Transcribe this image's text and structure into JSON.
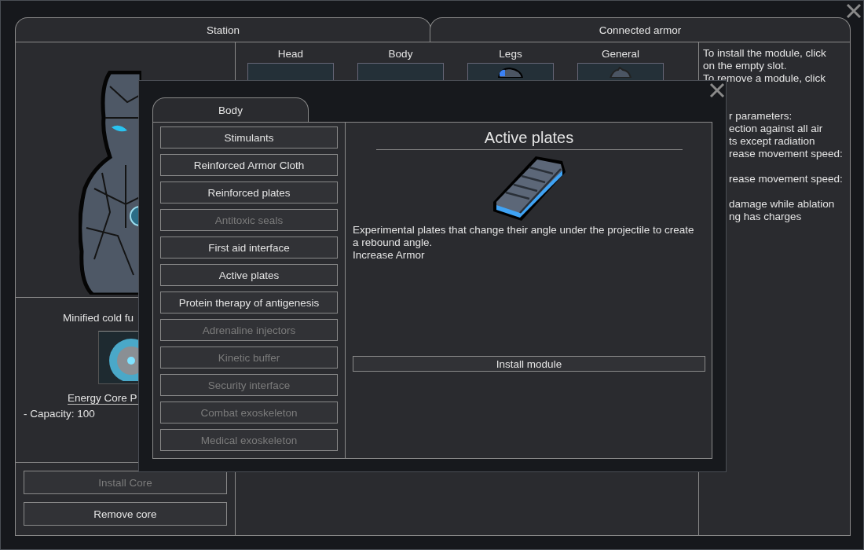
{
  "window": {
    "tabs": [
      {
        "label": "Station"
      },
      {
        "label": "Connected armor"
      }
    ]
  },
  "core": {
    "name": "Minified cold fu",
    "item": "Energy Core P",
    "stats": "- Capacity: 100"
  },
  "core_buttons": [
    {
      "label": "Install Core",
      "disabled": true
    },
    {
      "label": "Remove core",
      "disabled": false
    }
  ],
  "slots": [
    {
      "label": "Head",
      "kind": "empty"
    },
    {
      "label": "Body",
      "kind": "empty"
    },
    {
      "label": "Legs",
      "kind": "legs"
    },
    {
      "label": "General",
      "kind": "general"
    }
  ],
  "hints": [
    [
      "To install the module, click",
      "on the empty slot.",
      "To remove a module, click"
    ],
    [
      "r parameters:",
      "ection against all air",
      "ts except radiation",
      "rease movement speed:"
    ],
    [
      "rease movement speed:"
    ],
    [
      "damage while ablation",
      "ng has charges"
    ]
  ],
  "dialog": {
    "tab": "Body",
    "modules": [
      {
        "label": "Stimulants",
        "disabled": false
      },
      {
        "label": "Reinforced Armor Cloth",
        "disabled": false
      },
      {
        "label": "Reinforced plates",
        "disabled": false
      },
      {
        "label": "Antitoxic seals",
        "disabled": true
      },
      {
        "label": "First aid interface",
        "disabled": false
      },
      {
        "label": "Active plates",
        "disabled": false
      },
      {
        "label": "Protein therapy of antigenesis",
        "disabled": false
      },
      {
        "label": "Adrenaline injectors",
        "disabled": true
      },
      {
        "label": "Kinetic buffer",
        "disabled": true
      },
      {
        "label": "Security interface",
        "disabled": true
      },
      {
        "label": "Combat exoskeleton",
        "disabled": true
      },
      {
        "label": "Medical exoskeleton",
        "disabled": true
      }
    ],
    "detail": {
      "title": "Active plates",
      "description": "Experimental plates that change their angle under the projectile to create a rebound angle.",
      "effect": "Increase Armor",
      "button": "Install module"
    }
  }
}
